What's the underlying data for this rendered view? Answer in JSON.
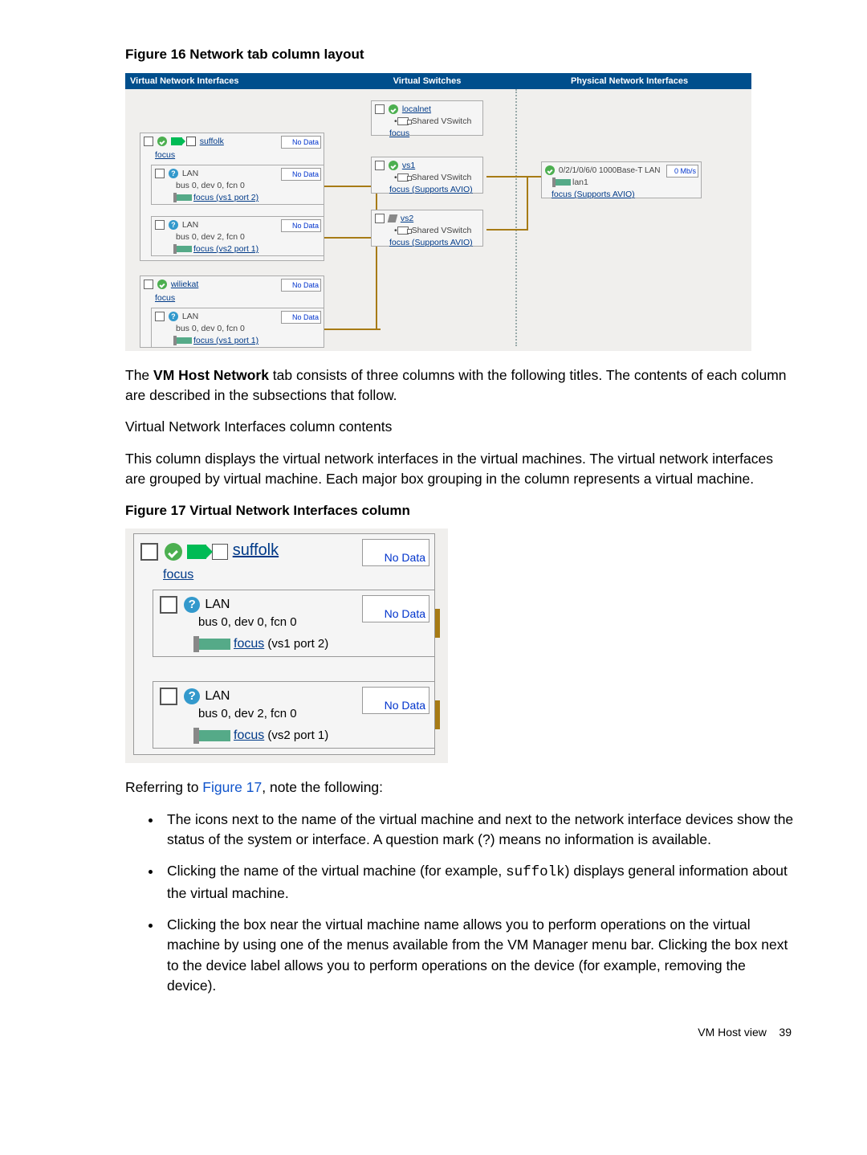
{
  "fig16": {
    "caption": "Figure 16 Network tab column layout",
    "headers": [
      "Virtual Network Interfaces",
      "Virtual Switches",
      "Physical Network Interfaces"
    ],
    "vni": {
      "vm1": {
        "name": "suffolk",
        "host": "focus",
        "badge": "No Data",
        "nics": [
          {
            "label": "LAN",
            "bus": "bus 0, dev 0, fcn 0",
            "port": "focus (vs1 port 2)",
            "badge": "No Data"
          },
          {
            "label": "LAN",
            "bus": "bus 0, dev 2, fcn 0",
            "port": "focus (vs2 port 1)",
            "badge": "No Data"
          }
        ]
      },
      "vm2": {
        "name": "wiliekat",
        "host": "focus",
        "badge": "No Data",
        "nics": [
          {
            "label": "LAN",
            "bus": "bus 0, dev 0, fcn 0",
            "port": "focus (vs1 port 1)",
            "badge": "No Data"
          }
        ]
      }
    },
    "switches": [
      {
        "name": "localnet",
        "swtype": "Shared VSwitch",
        "host": "focus"
      },
      {
        "name": "vs1",
        "swtype": "Shared VSwitch",
        "host": "focus (Supports AVIO)"
      },
      {
        "name": "vs2",
        "swtype": "Shared VSwitch",
        "host": "focus (Supports AVIO)"
      }
    ],
    "pni": {
      "name": "0/2/1/0/6/0 1000Base-T LAN",
      "lan": "lan1",
      "rate": "0 Mb/s",
      "host": "focus (Supports AVIO)"
    }
  },
  "body": {
    "p1a": "The ",
    "p1b": "VM Host Network",
    "p1c": " tab consists of three columns with the following titles. The contents of each column are described in the subsections that follow.",
    "p2": "Virtual Network Interfaces column contents",
    "p3": "This column displays the virtual network interfaces in the virtual machines. The virtual network interfaces are grouped by virtual machine. Each major box grouping in the column represents a virtual machine."
  },
  "fig17": {
    "caption": "Figure 17 Virtual Network Interfaces column",
    "vm": {
      "name": "suffolk",
      "host": "focus",
      "badge": "No Data",
      "nics": [
        {
          "label": "LAN",
          "bus": "bus 0, dev 0, fcn 0",
          "port": "focus (vs1 port 2)",
          "badge": "No Data"
        },
        {
          "label": "LAN",
          "bus": "bus 0, dev 2, fcn 0",
          "port": "focus (vs2 port 1)",
          "badge": "No Data"
        }
      ]
    }
  },
  "after": {
    "lead_a": "Referring to ",
    "lead_link": "Figure 17",
    "lead_b": ", note the following:",
    "bullets": [
      "The icons next to the name of the virtual machine and next to the network interface devices show the status of the system or interface. A question mark (?) means no information is available.",
      "Clicking the name of the virtual machine (for example, suffolk) displays general information about the virtual machine.",
      "Clicking the box near the virtual machine name allows you to perform operations on the virtual machine by using one of the menus available from the VM Manager menu bar. Clicking the box next to the device label allows you to perform operations on the device (for example, removing the device)."
    ],
    "bullet2_pre": "Clicking the name of the virtual machine (for example, ",
    "bullet2_code": "suffolk",
    "bullet2_post": ") displays general information about the virtual machine."
  },
  "footer": {
    "section": "VM Host view",
    "page": "39"
  }
}
